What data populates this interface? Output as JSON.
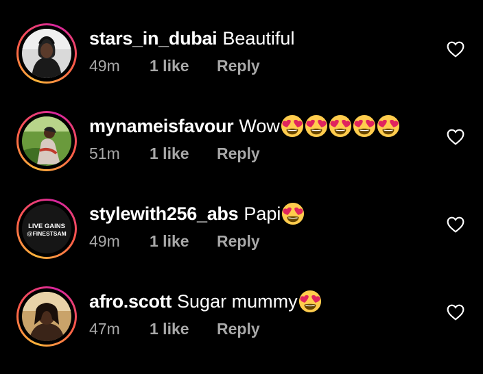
{
  "comments": [
    {
      "username": "stars_in_dubai",
      "text": "Beautiful",
      "emoji_count": 0,
      "time": "49m",
      "likes": "1 like",
      "reply": "Reply",
      "avatar": "avatar-photo-person-hoodie"
    },
    {
      "username": "mynameisfavour",
      "text": "Wow",
      "emoji_count": 5,
      "time": "51m",
      "likes": "1 like",
      "reply": "Reply",
      "avatar": "avatar-photo-woman-outdoors"
    },
    {
      "username": "stylewith256_abs",
      "text": "Papi",
      "emoji_count": 1,
      "time": "49m",
      "likes": "1 like",
      "reply": "Reply",
      "avatar": "avatar-logo",
      "avatar_text": [
        "LIVE GAINS",
        "@FINESTSAM"
      ]
    },
    {
      "username": "afro.scott",
      "text": "Sugar mummy",
      "emoji_count": 1,
      "time": "47m",
      "likes": "1 like",
      "reply": "Reply",
      "avatar": "avatar-photo-woman-selfie"
    }
  ],
  "emoji": "heart-eyes-emoji",
  "like_icon": "heart-outline-icon",
  "colors": {
    "background": "#000000",
    "text": "#ffffff",
    "meta": "#a8a8a8",
    "story_ring": [
      "#fdb53b",
      "#fd5949",
      "#d6249f"
    ]
  }
}
